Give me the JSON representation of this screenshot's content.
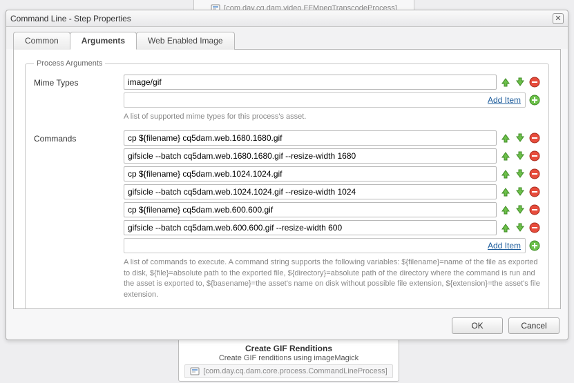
{
  "top_bar": {
    "label": "[com.day.cq.dam.video.FFMpegTranscodeProcess]"
  },
  "dialog": {
    "title": "Command Line - Step Properties",
    "tabs": [
      {
        "label": "Common",
        "active": false
      },
      {
        "label": "Arguments",
        "active": true
      },
      {
        "label": "Web Enabled Image",
        "active": false
      }
    ],
    "fieldset_legend": "Process Arguments",
    "mime": {
      "label": "Mime Types",
      "items": [
        "image/gif"
      ],
      "add_label": "Add Item",
      "help": "A list of supported mime types for this process's asset."
    },
    "commands": {
      "label": "Commands",
      "items": [
        "cp ${filename} cq5dam.web.1680.1680.gif",
        "gifsicle --batch cq5dam.web.1680.1680.gif --resize-width 1680",
        "cp ${filename} cq5dam.web.1024.1024.gif",
        "gifsicle --batch cq5dam.web.1024.1024.gif --resize-width 1024",
        "cp ${filename} cq5dam.web.600.600.gif",
        "gifsicle --batch cq5dam.web.600.600.gif --resize-width 600"
      ],
      "add_label": "Add Item",
      "help": "A list of commands to execute. A command string supports the following variables: ${filename}=name of the file as exported to disk, ${file}=absolute path to the exported file, ${directory}=absolute path of the directory where the command is run and the asset is exported to, ${basename}=the asset's name on disk without possible file extension, ${extension}=the asset's file extension."
    },
    "ok_label": "OK",
    "cancel_label": "Cancel"
  },
  "bottom_box": {
    "title": "Create GIF Renditions",
    "subtitle": "Create GIF renditions using imageMagick",
    "link": "[com.day.cq.dam.core.process.CommandLineProcess]"
  }
}
